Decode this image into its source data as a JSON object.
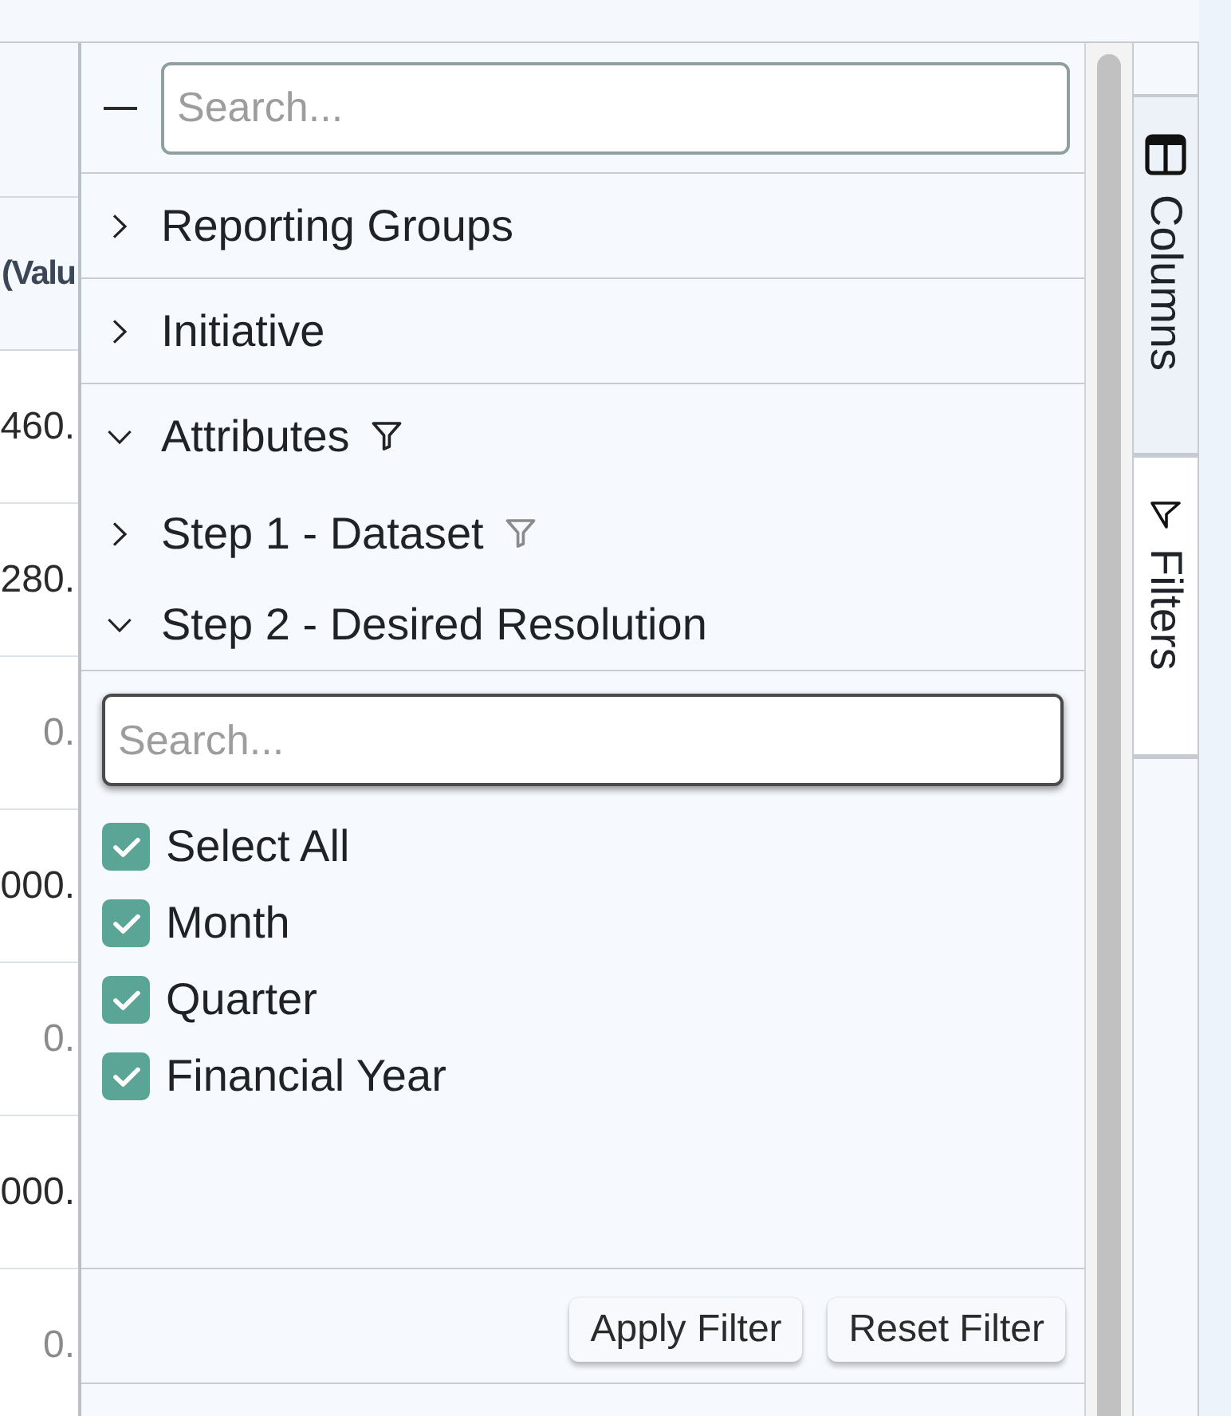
{
  "grid": {
    "header": "(Valu",
    "cells": [
      {
        "text": "460.",
        "muted": false
      },
      {
        "text": "280.",
        "muted": false
      },
      {
        "text": "0.",
        "muted": true
      },
      {
        "text": "000.",
        "muted": false
      },
      {
        "text": "0.",
        "muted": true
      },
      {
        "text": "000.",
        "muted": false
      },
      {
        "text": "0.",
        "muted": true
      }
    ]
  },
  "filter_panel": {
    "expand_all": {
      "indeterminate": true
    },
    "search": {
      "placeholder": "Search...",
      "focused": false
    },
    "groups": [
      {
        "label": "Reporting Groups",
        "expanded": false
      },
      {
        "label": "Initiative",
        "expanded": false
      },
      {
        "label": "Attributes",
        "expanded": true,
        "funnel": {
          "active": true
        },
        "children": [
          {
            "label": "Step 1 - Dataset",
            "expanded": false,
            "funnel": {
              "active": false
            }
          },
          {
            "label": "Step 2 - Desired Resolution",
            "expanded": true,
            "filter": {
              "search": {
                "placeholder": "Search...",
                "focused": true
              },
              "options": [
                {
                  "label": "Select All",
                  "checked": true
                },
                {
                  "label": "Month",
                  "checked": true
                },
                {
                  "label": "Quarter",
                  "checked": true
                },
                {
                  "label": "Financial Year",
                  "checked": true
                }
              ],
              "buttons": [
                "Apply Filter",
                "Reset Filter"
              ]
            }
          }
        ]
      }
    ]
  },
  "side_tabs": [
    {
      "kind": "columns",
      "label": "Columns",
      "selected": false
    },
    {
      "kind": "filters",
      "label": "Filters",
      "selected": true
    }
  ]
}
